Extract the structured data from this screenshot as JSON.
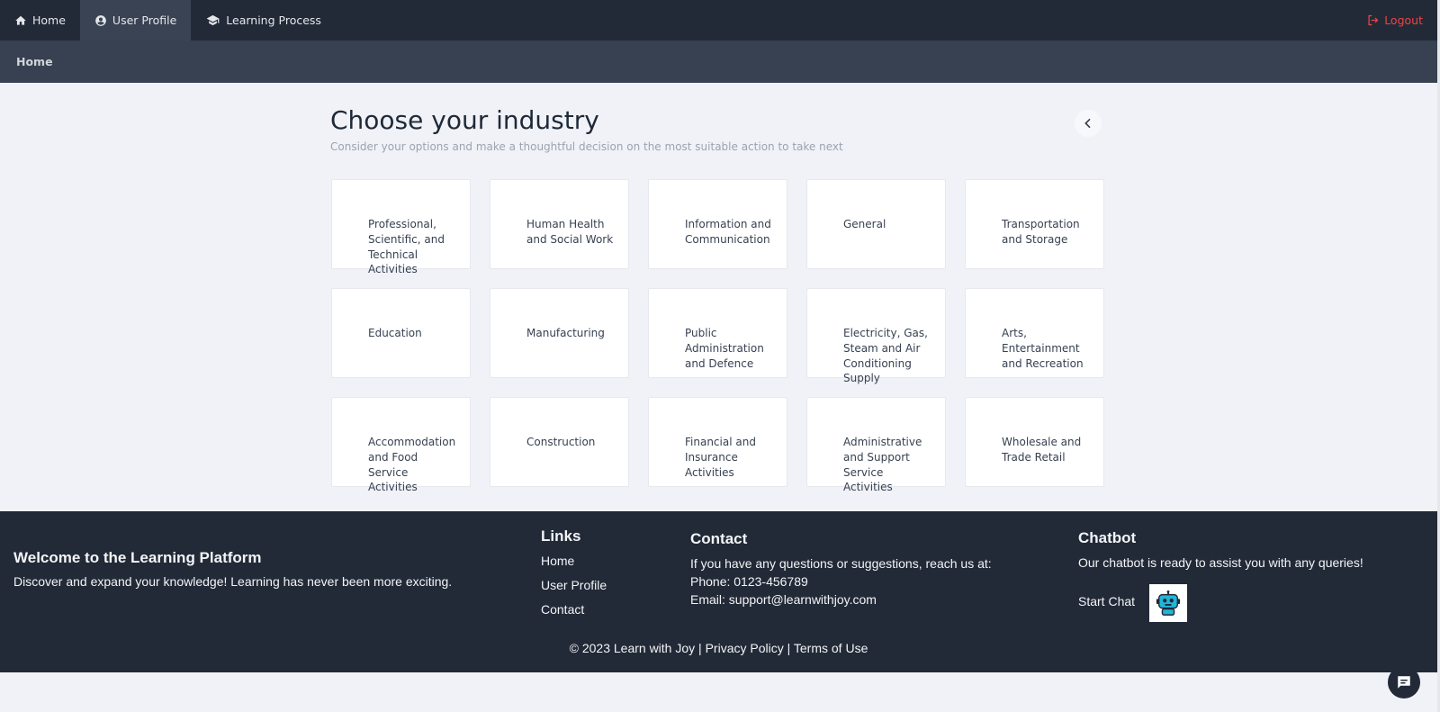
{
  "nav": {
    "items": [
      {
        "label": "Home",
        "icon": "home-icon"
      },
      {
        "label": "User Profile",
        "icon": "user-circle-icon"
      },
      {
        "label": "Learning Process",
        "icon": "graduation-cap-icon"
      }
    ],
    "logout_label": "Logout"
  },
  "breadcrumb": {
    "label": "Home"
  },
  "main": {
    "title": "Choose your industry",
    "subtitle": "Consider your options and make a thoughtful decision on the most suitable action to take next",
    "industries": [
      "Professional, Scientific, and Technical Activities",
      "Human Health and Social Work",
      "Information and Communication",
      "General",
      "Transportation and Storage",
      "Education",
      "Manufacturing",
      "Public Administration and Defence",
      "Electricity, Gas, Steam and Air Conditioning Supply",
      "Arts, Entertainment and Recreation",
      "Accommodation and Food Service Activities",
      "Construction",
      "Financial and Insurance Activities",
      "Administrative and Support Service Activities",
      "Wholesale and Trade Retail"
    ]
  },
  "footer": {
    "welcome_title": "Welcome to the Learning Platform",
    "welcome_text": "Discover and expand your knowledge! Learning has never been more exciting.",
    "links_title": "Links",
    "links": [
      "Home",
      "User Profile",
      "Contact"
    ],
    "contact_title": "Contact",
    "contact_intro": "If you have any questions or suggestions, reach us at:",
    "contact_phone": "Phone: 0123-456789",
    "contact_email": "Email: support@learnwithjoy.com",
    "chatbot_title": "Chatbot",
    "chatbot_text": "Our chatbot is ready to assist you with any queries!",
    "chatbot_start": "Start Chat",
    "copyright": "© 2023 Learn with Joy",
    "privacy": "Privacy Policy",
    "terms": "Terms of Use",
    "separator": "|"
  },
  "colors": {
    "nav_bg": "#222a38",
    "nav_active": "#394353",
    "breadcrumb_bg": "#374151",
    "page_bg": "#f0f2f7",
    "logout": "#ef4444",
    "bot_accent": "#22b5d8"
  }
}
